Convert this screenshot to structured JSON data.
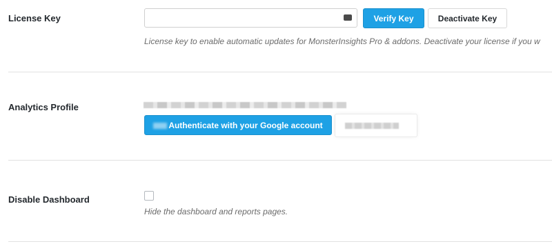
{
  "license": {
    "label": "License Key",
    "input_value": "",
    "input_placeholder": "",
    "key_icon": "password-dots-icon",
    "verify_label": "Verify Key",
    "deactivate_label": "Deactivate Key",
    "help": "License key to enable automatic updates for MonsterInsights Pro & addons. Deactivate your license if you w"
  },
  "analytics": {
    "label": "Analytics Profile",
    "authenticate_label": "Authenticate with your Google account"
  },
  "dashboard": {
    "label": "Disable Dashboard",
    "checked": false,
    "help": "Hide the dashboard and reports pages."
  },
  "colors": {
    "primary": "#1ea1e5",
    "text": "#23282d",
    "help_text": "#6b6b6b",
    "divider": "#e1e1e1"
  }
}
